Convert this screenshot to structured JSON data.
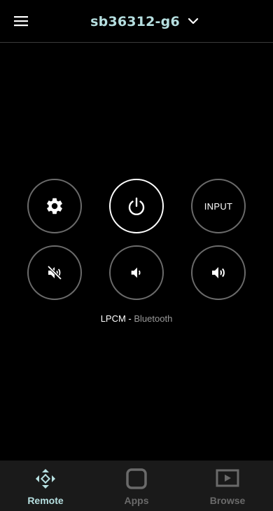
{
  "header": {
    "title": "sb36312-g6"
  },
  "controls": {
    "input_label": "INPUT"
  },
  "status": {
    "format": "LPCM",
    "separator": " - ",
    "source": "Bluetooth"
  },
  "nav": {
    "remote": "Remote",
    "apps": "Apps",
    "browse": "Browse"
  },
  "colors": {
    "accent": "#b6dfe0",
    "inactive": "#6a6a6a",
    "ring": "#6b6b6b",
    "nav_bg": "#1a1a1a"
  },
  "icons": [
    "menu-icon",
    "chevron-down-icon",
    "gear-icon",
    "power-icon",
    "mute-icon",
    "volume-down-icon",
    "volume-up-icon",
    "dpad-icon",
    "apps-icon",
    "play-icon"
  ]
}
